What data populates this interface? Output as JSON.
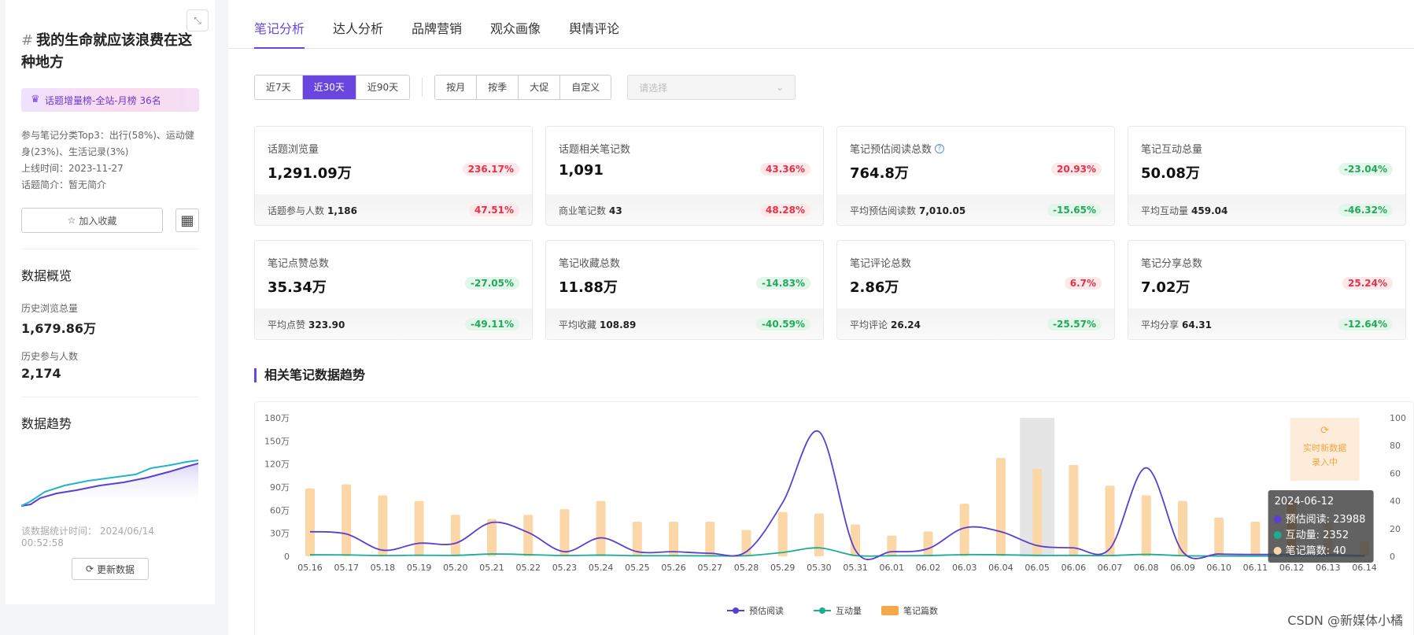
{
  "sidebar": {
    "title_hash": "#",
    "title": "我的生命就应该浪费在这种地方",
    "rank_badge": "话题增量榜-全站-月榜 36名",
    "meta": {
      "categories": "参与笔记分类Top3：出行(58%)、运动健身(23%)、生活记录(3%)",
      "online_time": "上线时间：2023-11-27",
      "intro": "话题简介：暂无简介"
    },
    "favorite_label": "加入收藏",
    "overview_title": "数据概览",
    "history_views_label": "历史浏览总量",
    "history_views_value": "1,679.86万",
    "history_participants_label": "历史参与人数",
    "history_participants_value": "2,174",
    "trend_title": "数据趋势",
    "stat_time": "该数据统计时间：  2024/06/14 00:52:58",
    "refresh_label": "更新数据"
  },
  "tabs": [
    "笔记分析",
    "达人分析",
    "品牌营销",
    "观众画像",
    "舆情评论"
  ],
  "filters": {
    "range": [
      "近7天",
      "近30天",
      "近90天"
    ],
    "period": [
      "按月",
      "按季",
      "大促",
      "自定义"
    ],
    "select_placeholder": "请选择"
  },
  "cards": [
    {
      "label": "话题浏览量",
      "value": "1,291.09万",
      "change": "236.17%",
      "dir": "up",
      "sub_label": "话题参与人数",
      "sub_value": "1,186",
      "sub_change": "47.51%",
      "sub_dir": "up"
    },
    {
      "label": "话题相关笔记数",
      "value": "1,091",
      "change": "43.36%",
      "dir": "up",
      "sub_label": "商业笔记数",
      "sub_value": "43",
      "sub_change": "48.28%",
      "sub_dir": "up"
    },
    {
      "label": "笔记预估阅读总数",
      "value": "764.8万",
      "change": "20.93%",
      "dir": "up",
      "sub_label": "平均预估阅读数",
      "sub_value": "7,010.05",
      "sub_change": "-15.65%",
      "sub_dir": "down",
      "help": true
    },
    {
      "label": "笔记互动总量",
      "value": "50.08万",
      "change": "-23.04%",
      "dir": "down",
      "sub_label": "平均互动量",
      "sub_value": "459.04",
      "sub_change": "-46.32%",
      "sub_dir": "down"
    },
    {
      "label": "笔记点赞总数",
      "value": "35.34万",
      "change": "-27.05%",
      "dir": "down",
      "sub_label": "平均点赞",
      "sub_value": "323.90",
      "sub_change": "-49.11%",
      "sub_dir": "down"
    },
    {
      "label": "笔记收藏总数",
      "value": "11.88万",
      "change": "-14.83%",
      "dir": "down",
      "sub_label": "平均收藏",
      "sub_value": "108.89",
      "sub_change": "-40.59%",
      "sub_dir": "down"
    },
    {
      "label": "笔记评论总数",
      "value": "2.86万",
      "change": "6.7%",
      "dir": "up",
      "sub_label": "平均评论",
      "sub_value": "26.24",
      "sub_change": "-25.57%",
      "sub_dir": "down"
    },
    {
      "label": "笔记分享总数",
      "value": "7.02万",
      "change": "25.24%",
      "dir": "up",
      "sub_label": "平均分享",
      "sub_value": "64.31",
      "sub_change": "-12.64%",
      "sub_dir": "down"
    }
  ],
  "section_title": "相关笔记数据趋势",
  "colors": {
    "accent": "#6a46e0",
    "read": "#5b3fd1",
    "interact": "#1aad8f",
    "notes": "#fbd7a8",
    "up": "#e2334a",
    "down": "#26a65b"
  },
  "chart_data": {
    "type": "bar",
    "x": [
      "05.16",
      "05.17",
      "05.18",
      "05.19",
      "05.20",
      "05.21",
      "05.22",
      "05.23",
      "05.24",
      "05.25",
      "05.26",
      "05.27",
      "05.28",
      "05.29",
      "05.30",
      "05.31",
      "06.01",
      "06.02",
      "06.03",
      "06.04",
      "06.05",
      "06.06",
      "06.07",
      "06.08",
      "06.09",
      "06.10",
      "06.11",
      "06.12",
      "06.13",
      "06.14"
    ],
    "y_left_ticks": [
      "0",
      "30万",
      "60万",
      "90万",
      "120万",
      "150万",
      "180万"
    ],
    "y_left_max": 1800000,
    "y_right_ticks": [
      "0",
      "20",
      "40",
      "60",
      "80",
      "100"
    ],
    "y_right_max": 100,
    "series": [
      {
        "name": "预估阅读",
        "type": "line",
        "axis": "left",
        "values": [
          320000,
          290000,
          80000,
          170000,
          170000,
          440000,
          310000,
          60000,
          240000,
          60000,
          60000,
          40000,
          60000,
          700000,
          1620000,
          80000,
          60000,
          100000,
          370000,
          320000,
          140000,
          110000,
          100000,
          1150000,
          60000,
          30000,
          24000,
          23988,
          20000,
          10000
        ]
      },
      {
        "name": "互动量",
        "type": "line",
        "axis": "left",
        "values": [
          20000,
          18000,
          10000,
          14000,
          12000,
          30000,
          22000,
          10000,
          16000,
          8000,
          8000,
          6000,
          8000,
          50000,
          110000,
          10000,
          8000,
          10000,
          22000,
          20000,
          12000,
          12000,
          10000,
          25000,
          8000,
          4000,
          3000,
          2352,
          2000,
          1000
        ]
      },
      {
        "name": "笔记篇数",
        "type": "bar",
        "axis": "right",
        "values": [
          49,
          52,
          44,
          40,
          30,
          27,
          30,
          34,
          40,
          25,
          25,
          25,
          19,
          32,
          31,
          23,
          15,
          18,
          38,
          71,
          63,
          66,
          51,
          44,
          40,
          28,
          25,
          40,
          25,
          11
        ]
      }
    ],
    "highlight_index": 20,
    "tooltip": {
      "date": "2024-06-12",
      "lines": [
        "预估阅读: 23988",
        "互动量: 2352",
        "笔记篇数: 40"
      ]
    },
    "realtime_label": [
      "实时新数据",
      "录入中"
    ],
    "legend": [
      "预估阅读",
      "互动量",
      "笔记篇数"
    ]
  },
  "watermark": "CSDN @新媒体小橘"
}
